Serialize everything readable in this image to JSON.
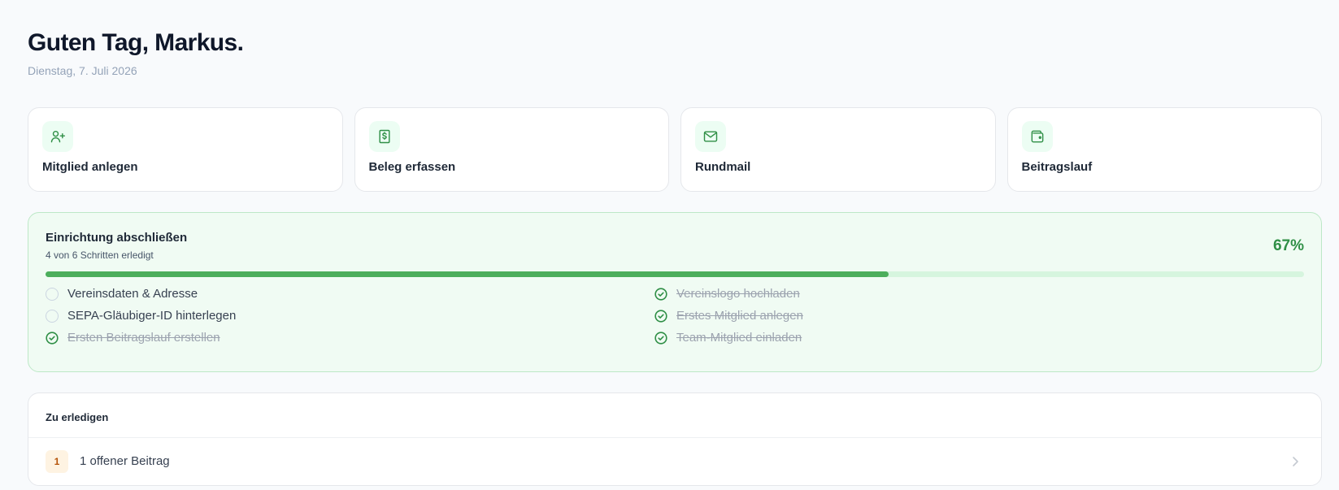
{
  "header": {
    "greeting": "Guten Tag, Markus.",
    "date": "Dienstag, 7. Juli 2026"
  },
  "quick_actions": [
    {
      "label": "Mitglied anlegen",
      "icon": "user-plus-icon"
    },
    {
      "label": "Beleg erfassen",
      "icon": "receipt-icon"
    },
    {
      "label": "Rundmail",
      "icon": "mail-icon"
    },
    {
      "label": "Beitragslauf",
      "icon": "wallet-icon"
    }
  ],
  "setup": {
    "title": "Einrichtung abschließen",
    "subtitle": "4 von 6 Schritten erledigt",
    "percent_label": "67%",
    "progress": 0.67,
    "steps": [
      {
        "label": "Vereinsdaten & Adresse",
        "done": false
      },
      {
        "label": "SEPA-Gläubiger-ID hinterlegen",
        "done": false
      },
      {
        "label": "Ersten Beitragslauf erstellen",
        "done": true
      },
      {
        "label": "Vereinslogo hochladen",
        "done": true
      },
      {
        "label": "Erstes Mitglied anlegen",
        "done": true
      },
      {
        "label": "Team-Mitglied einladen",
        "done": true
      }
    ]
  },
  "todo": {
    "title": "Zu erledigen",
    "items": [
      {
        "count": "1",
        "label": "1 offener Beitrag"
      }
    ]
  },
  "colors": {
    "accent": "#2f8f46",
    "progress_fill": "#4cae5c",
    "setup_background": "#f0fbf3",
    "badge_background": "#fef3e2",
    "badge_text": "#b45309"
  }
}
